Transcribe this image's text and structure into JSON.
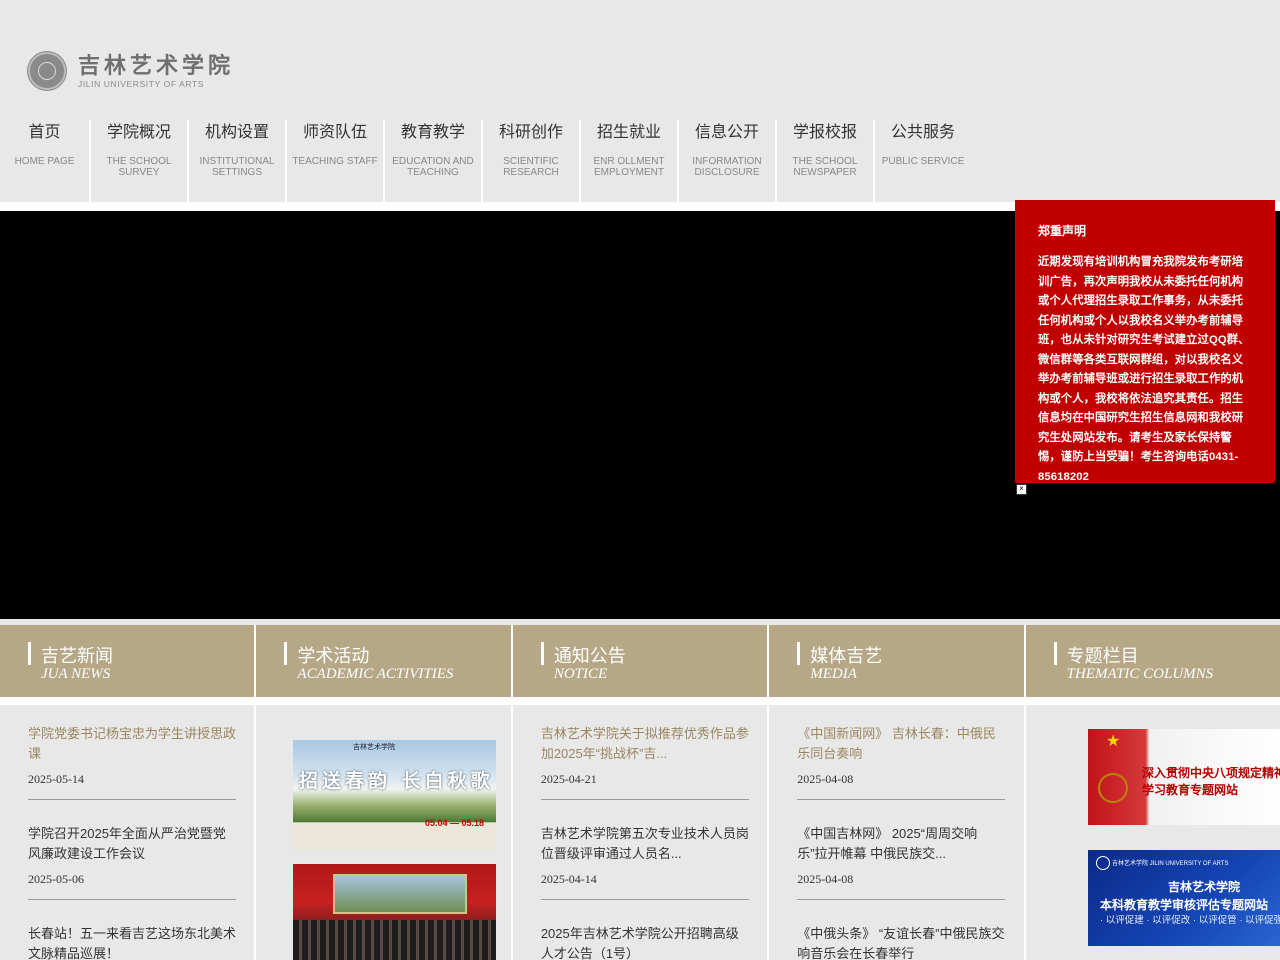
{
  "logo": {
    "cn": "吉林艺术学院",
    "en": "JILIN UNIVERSITY OF ARTS"
  },
  "nav": [
    {
      "cn": "首页",
      "en": "HOME PAGE"
    },
    {
      "cn": "学院概况",
      "en": "THE SCHOOL SURVEY"
    },
    {
      "cn": "机构设置",
      "en": "INSTITUTIONAL SETTINGS"
    },
    {
      "cn": "师资队伍",
      "en": "TEACHING STAFF"
    },
    {
      "cn": "教育教学",
      "en": "EDUCATION AND TEACHING"
    },
    {
      "cn": "科研创作",
      "en": "SCIENTIFIC RESEARCH"
    },
    {
      "cn": "招生就业",
      "en": "ENR OLLMENT EMPLOYMENT"
    },
    {
      "cn": "信息公开",
      "en": "INFORMATION DISCLOSURE"
    },
    {
      "cn": "学报校报",
      "en": "THE SCHOOL NEWSPAPER"
    },
    {
      "cn": "公共服务",
      "en": "PUBLIC SERVICE"
    }
  ],
  "popup": {
    "title": "郑重声明",
    "body": "近期发现有培训机构冒充我院发布考研培训广告，再次声明我校从未委托任何机构或个人代理招生录取工作事务，从未委托任何机构或个人以我校名义举办考前辅导班，也从未针对研究生考试建立过QQ群、微信群等各类互联网群组，对以我校名义举办考前辅导班或进行招生录取工作的机构或个人，我校将依法追究其责任。招生信息均在中国研究生招生信息网和我校研究生处网站发布。请考生及家长保持警惕，谨防上当受骗！考生咨询电话0431-85618202",
    "close": "×"
  },
  "sections": [
    {
      "cn": "吉艺新闻",
      "en": "JUA NEWS"
    },
    {
      "cn": "学术活动",
      "en": "ACADEMIC ACTIVITIES"
    },
    {
      "cn": "通知公告",
      "en": "NOTICE"
    },
    {
      "cn": "媒体吉艺",
      "en": "MEDIA"
    },
    {
      "cn": "专题栏目",
      "en": "THEMATIC COLUMNS"
    }
  ],
  "jua_news": [
    {
      "title": "学院党委书记杨宝忠为学生讲授思政课",
      "date": "2025-05-14"
    },
    {
      "title": "学院召开2025年全面从严治党暨党风廉政建设工作会议",
      "date": "2025-05-06"
    },
    {
      "title": "长春站！五一来看吉艺这场东北美术文脉精品巡展！",
      "date": ""
    }
  ],
  "academic": {
    "poster1_title": "招送春韵 长白秋歌",
    "poster1_header": "吉林艺术学院",
    "poster1_date": "05.04 — 05.18"
  },
  "notice": [
    {
      "title": "吉林艺术学院关于拟推荐优秀作品参加2025年“挑战杯”吉...",
      "date": "2025-04-21"
    },
    {
      "title": "吉林艺术学院第五次专业技术人员岗位晋级评审通过人员名...",
      "date": "2025-04-14"
    },
    {
      "title": "2025年吉林艺术学院公开招聘高级人才公告（1号）",
      "date": ""
    }
  ],
  "media": [
    {
      "title": "《中国新闻网》 吉林长春：中俄民乐同台奏响",
      "date": "2025-04-08"
    },
    {
      "title": "《中国吉林网》 2025“周周交响乐”拉开帷幕 中俄民族交...",
      "date": "2025-04-08"
    },
    {
      "title": "《中俄头条》 “友谊长春”中俄民族交响音乐会在长春举行",
      "date": ""
    }
  ],
  "topics": {
    "t1": "深入贯彻中央八项规定精神学习教育专题网站",
    "t1_line1": "深入贯彻中央八项规定精神",
    "t1_line2": "学习教育专题网站",
    "t2_school": "吉林艺术学院",
    "t2_title": "本科教育教学审核评估专题网站",
    "t2_slogan": "· 以评促建 · 以评促改 · 以评促管 · 以评促强",
    "t2_mini": "吉林艺术学院 JILIN UNIVERSITY OF ARTS"
  },
  "colors": {
    "accent": "#b6a887",
    "popup": "#c00000",
    "highlight_text": "#9a8760"
  }
}
